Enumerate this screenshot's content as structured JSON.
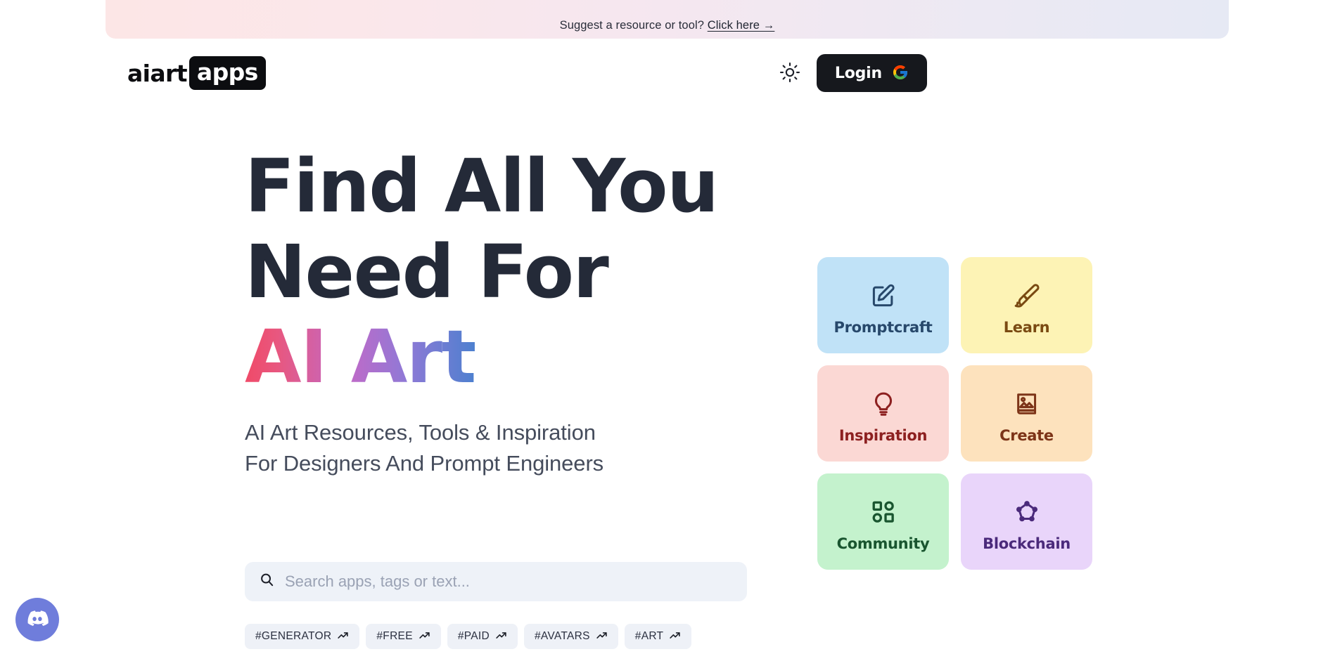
{
  "banner": {
    "text": "Suggest a resource or tool?",
    "link_label": "Click here →"
  },
  "header": {
    "logo_word": "aiart",
    "logo_badge": "apps",
    "theme_toggle_icon": "sun-icon",
    "login_label": "Login",
    "login_provider_icon": "google-icon"
  },
  "hero": {
    "headline_line1": "Find All You",
    "headline_line2": "Need For",
    "headline_accent": "AI Art",
    "subhead_line1": "AI Art Resources, Tools & Inspiration",
    "subhead_line2": "For Designers And Prompt Engineers",
    "accent_gradient": [
      "#f04a68",
      "#c06ac8",
      "#4d80cf"
    ]
  },
  "search": {
    "icon": "search-icon",
    "placeholder": "Search apps, tags or text...",
    "value": ""
  },
  "tags": [
    {
      "label": "#GENERATOR",
      "icon": "trending-up-icon"
    },
    {
      "label": "#FREE",
      "icon": "trending-up-icon"
    },
    {
      "label": "#PAID",
      "icon": "trending-up-icon"
    },
    {
      "label": "#AVATARS",
      "icon": "trending-up-icon"
    },
    {
      "label": "#ART",
      "icon": "trending-up-icon"
    }
  ],
  "categories": [
    {
      "label": "Promptcraft",
      "icon": "pencil-square-icon",
      "bg": "#c0e2f7",
      "fg": "#27486b"
    },
    {
      "label": "Learn",
      "icon": "paint-brush-icon",
      "bg": "#fdf3b5",
      "fg": "#7a4a12"
    },
    {
      "label": "Inspiration",
      "icon": "lightbulb-icon",
      "bg": "#fbd8d4",
      "fg": "#8d2020"
    },
    {
      "label": "Create",
      "icon": "image-book-icon",
      "bg": "#fde2bd",
      "fg": "#7d3418"
    },
    {
      "label": "Community",
      "icon": "grid-shapes-icon",
      "bg": "#c4f2cd",
      "fg": "#19552f"
    },
    {
      "label": "Blockchain",
      "icon": "blockchain-nodes-icon",
      "bg": "#e9d5fa",
      "fg": "#4b2a7b"
    }
  ],
  "floating": {
    "discord_icon": "discord-icon",
    "discord_color": "#6f7ddb"
  }
}
